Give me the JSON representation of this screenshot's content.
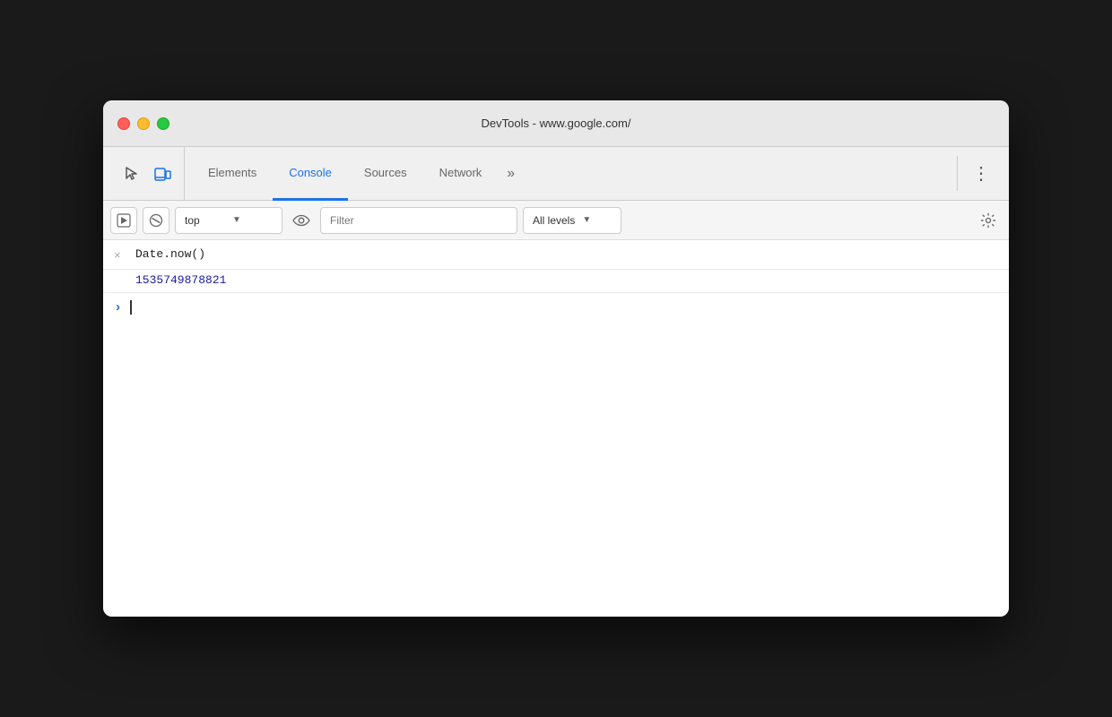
{
  "window": {
    "title": "DevTools - www.google.com/"
  },
  "titlebar": {
    "title": "DevTools - www.google.com/",
    "traffic_lights": [
      "close",
      "minimize",
      "maximize"
    ]
  },
  "tabs": {
    "items": [
      {
        "id": "elements",
        "label": "Elements",
        "active": false
      },
      {
        "id": "console",
        "label": "Console",
        "active": true
      },
      {
        "id": "sources",
        "label": "Sources",
        "active": false
      },
      {
        "id": "network",
        "label": "Network",
        "active": false
      }
    ],
    "more_label": "»",
    "menu_label": "⋮"
  },
  "console_toolbar": {
    "execute_icon": "▶",
    "block_icon": "⊘",
    "context_value": "top",
    "dropdown_arrow": "▼",
    "eye_icon": "👁",
    "filter_placeholder": "Filter",
    "level_label": "All levels",
    "level_arrow": "▼",
    "settings_icon": "⚙"
  },
  "console_entries": [
    {
      "id": "entry1",
      "icon": "×",
      "text": "Date.now()",
      "result": "1535749878821"
    }
  ],
  "console_input": {
    "prompt": ">",
    "value": ""
  }
}
